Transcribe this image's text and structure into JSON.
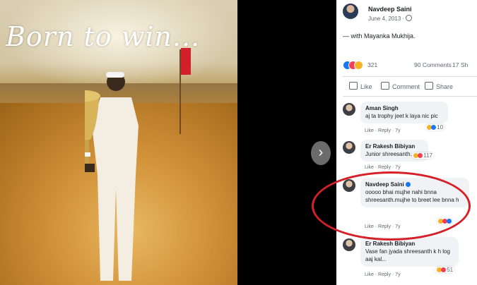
{
  "photo": {
    "slogan": "Born to win..."
  },
  "viewer": {
    "next_icon": "›"
  },
  "post": {
    "author": "Navdeep Saini",
    "date": "June 4, 2013 ·",
    "tagline": "— with Mayanka Mukhija.",
    "reactions_count": "321",
    "comments_count": "90 Comments",
    "shares_count": "17 Sh"
  },
  "actions": {
    "like": "Like",
    "comment": "Comment",
    "share": "Share"
  },
  "comments": [
    {
      "name": "Aman Singh",
      "text": "aj ta trophy jeet k laya nic pic",
      "meta": "Like · Reply · 7y",
      "reactions": "10"
    },
    {
      "name": "Er Rakesh Bibiyan",
      "text": "Junior shreesanth..",
      "meta": "Like · Reply · 7y",
      "reactions": "117"
    },
    {
      "name": "Navdeep Saini",
      "text": "ooooo bhai mujhe nahi bnna shreesanth.mujhe to breet lee bnna h",
      "meta": "Like · Reply · 7y",
      "reactions": ""
    },
    {
      "name": "Er Rakesh Bibiyan",
      "text": "Vase fan jyada shreesanth k h log aaj kal...",
      "meta": "Like · Reply · 7y",
      "reactions": "51"
    }
  ],
  "colors": {
    "highlight": "#d61f26",
    "link_blue": "#1877f2"
  }
}
